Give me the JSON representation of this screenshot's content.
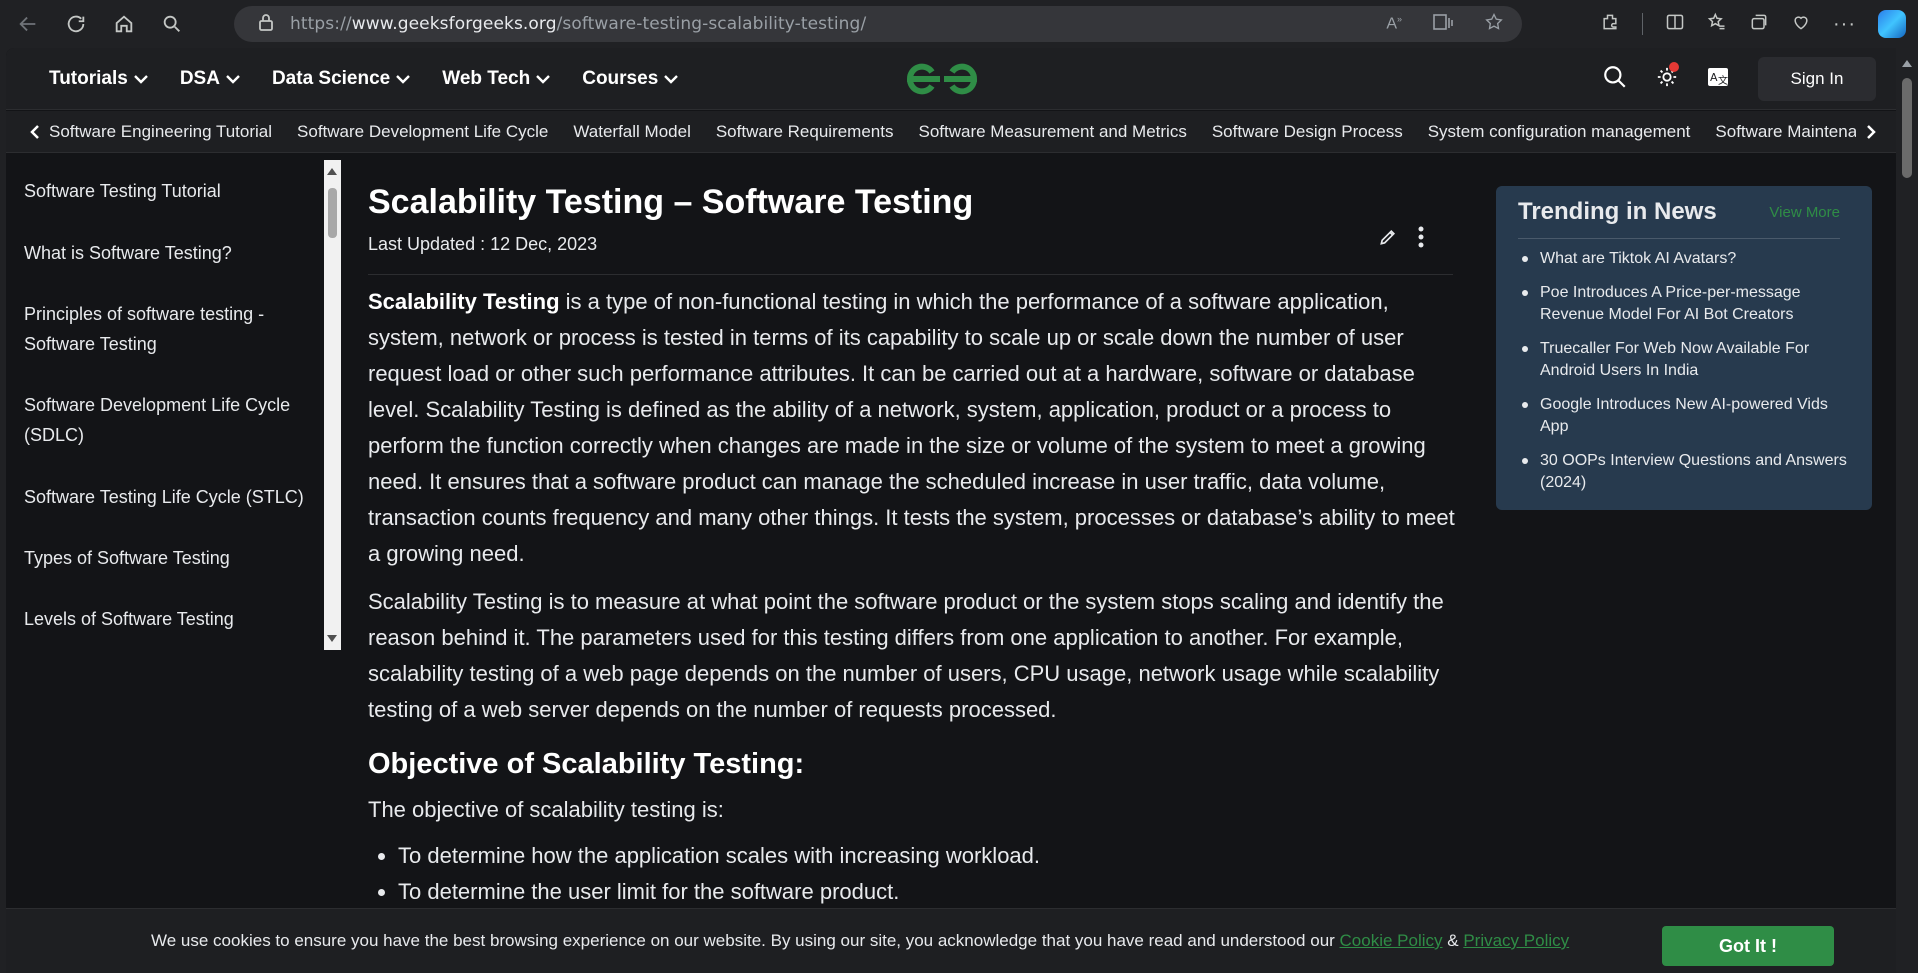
{
  "browser": {
    "url_prefix": "https://",
    "url_host": "www.geeksforgeeks.org",
    "url_path": "/software-testing-scalability-testing/"
  },
  "topnav": {
    "menu": [
      "Tutorials",
      "DSA",
      "Data Science",
      "Web Tech",
      "Courses"
    ],
    "sign_in": "Sign In",
    "brand_color": "#2f8d46"
  },
  "subnav": {
    "items": [
      "Software Engineering Tutorial",
      "Software Development Life Cycle",
      "Waterfall Model",
      "Software Requirements",
      "Software Measurement and Metrics",
      "Software Design Process",
      "System configuration management",
      "Software Maintenance"
    ]
  },
  "sidebar": {
    "items": [
      "Software Testing Tutorial",
      "What is Software Testing?",
      "Principles of software testing - Software Testing",
      "Software Development Life Cycle (SDLC)",
      "Software Testing Life Cycle (STLC)",
      "Types of Software Testing",
      "Levels of Software Testing"
    ]
  },
  "article": {
    "title": "Scalability Testing – Software Testing",
    "updated": "Last Updated : 12 Dec, 2023",
    "para1_bold": "Scalability Testing",
    "para1_rest": " is a type of non-functional testing in which the performance of a software application, system, network or process is tested in terms of its capability to scale up or scale down the number of user request load or other such performance attributes. It can be carried out at a hardware, software or database level. Scalability Testing is defined as the ability of a network, system, application, product or a process to perform the function correctly when changes are made in the size or volume of the system to meet a growing need. It ensures that a software product can manage the scheduled increase in user traffic, data volume, transaction counts frequency and many other things. It tests the system, processes or database’s ability to meet a growing need.",
    "para2": "Scalability Testing is to measure at what point the software product or the system stops scaling and identify the reason behind it. The parameters used for this testing differs from one application to another. For example, scalability testing of a web page depends on the number of users, CPU usage, network usage while scalability testing of a web server depends on the number of requests processed.",
    "h2": "Objective of Scalability Testing:",
    "obj_intro": "The objective of scalability testing is:",
    "bullets": [
      "To determine how the application scales with increasing workload.",
      "To determine the user limit for the software product."
    ]
  },
  "trending": {
    "title": "Trending in News",
    "view_more": "View More",
    "items": [
      "What are Tiktok AI Avatars?",
      "Poe Introduces A Price-per-message Revenue Model For AI Bot Creators",
      "Truecaller For Web Now Available For Android Users In India",
      "Google Introduces New AI-powered Vids App",
      "30 OOPs Interview Questions and Answers (2024)"
    ]
  },
  "cookie": {
    "text": "We use cookies to ensure you have the best browsing experience on our website. By using our site, you acknowledge that you have read and understood our ",
    "cookie_policy": "Cookie Policy",
    "amp": " & ",
    "privacy_policy": "Privacy Policy",
    "button": "Got It !"
  }
}
